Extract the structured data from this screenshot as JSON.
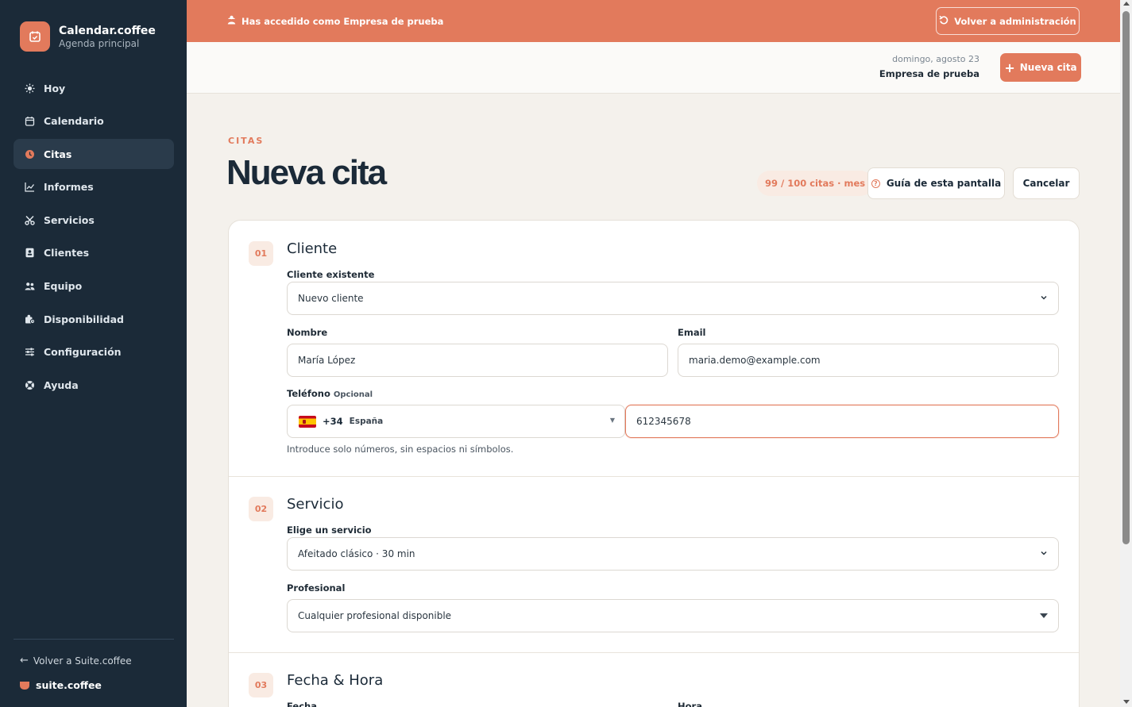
{
  "sidebar": {
    "brand_name": "Calendar.coffee",
    "brand_sub": "Agenda principal",
    "items": [
      {
        "label": "Hoy",
        "icon": "sun-icon"
      },
      {
        "label": "Calendario",
        "icon": "calendar-icon"
      },
      {
        "label": "Citas",
        "icon": "clock-icon",
        "active": true
      },
      {
        "label": "Informes",
        "icon": "chart-icon"
      },
      {
        "label": "Servicios",
        "icon": "scissors-icon"
      },
      {
        "label": "Clientes",
        "icon": "contact-card-icon"
      },
      {
        "label": "Equipo",
        "icon": "users-icon"
      },
      {
        "label": "Disponibilidad",
        "icon": "availability-icon"
      },
      {
        "label": "Configuración",
        "icon": "sliders-icon"
      },
      {
        "label": "Ayuda",
        "icon": "lifebuoy-icon"
      }
    ],
    "back_label": "Volver a Suite.coffee",
    "suite_label": "suite.coffee"
  },
  "banner": {
    "text": "Has accedido como Empresa de prueba",
    "button": "Volver a administración"
  },
  "topbar": {
    "date": "domingo, agosto 23",
    "company": "Empresa de prueba",
    "new_button": "Nueva cita"
  },
  "page": {
    "eyebrow": "CITAS",
    "title": "Nueva cita",
    "quota": "99 / 100 citas · mes",
    "guide_button": "Guía de esta pantalla",
    "cancel_button": "Cancelar"
  },
  "form": {
    "client": {
      "step": "01",
      "title": "Cliente",
      "existing_label": "Cliente existente",
      "existing_value": "Nuevo cliente",
      "name_label": "Nombre",
      "name_value": "María López",
      "email_label": "Email",
      "email_value": "maria.demo@example.com",
      "phone_label": "Teléfono",
      "phone_optional": "Opcional",
      "dial_code": "+34",
      "country": "España",
      "phone_value": "612345678",
      "phone_help": "Introduce solo números, sin espacios ni símbolos."
    },
    "service": {
      "step": "02",
      "title": "Servicio",
      "service_label": "Elige un servicio",
      "service_value": "Afeitado clásico · 30 min",
      "pro_label": "Profesional",
      "pro_value": "Cualquier profesional disponible"
    },
    "datetime": {
      "step": "03",
      "title": "Fecha & Hora",
      "date_label": "Fecha",
      "time_label": "Hora"
    }
  },
  "colors": {
    "accent": "#e27a5c",
    "sidebar_bg": "#1b2a38",
    "page_bg": "#f4f1ec"
  }
}
